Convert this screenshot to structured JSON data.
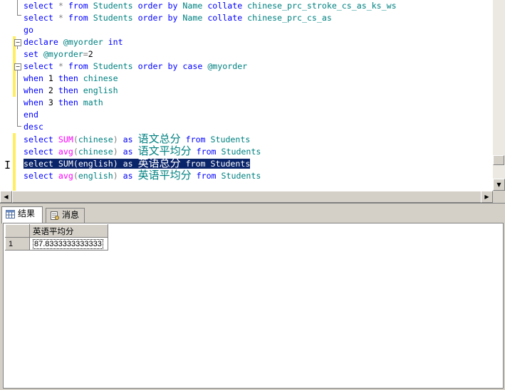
{
  "editor": {
    "lines": [
      [
        {
          "c": "kw",
          "t": "select"
        },
        {
          "c": "tx",
          "t": " "
        },
        {
          "c": "gr",
          "t": "*"
        },
        {
          "c": "tx",
          "t": " "
        },
        {
          "c": "kw",
          "t": "from"
        },
        {
          "c": "tx",
          "t": " "
        },
        {
          "c": "tl",
          "t": "Students"
        },
        {
          "c": "tx",
          "t": " "
        },
        {
          "c": "kw",
          "t": "order by"
        },
        {
          "c": "tx",
          "t": " "
        },
        {
          "c": "tl",
          "t": "Name"
        },
        {
          "c": "tx",
          "t": " "
        },
        {
          "c": "kw",
          "t": "collate"
        },
        {
          "c": "tx",
          "t": " "
        },
        {
          "c": "tl",
          "t": "chinese_prc_stroke_cs_as_ks_ws"
        }
      ],
      [
        {
          "c": "kw",
          "t": "select"
        },
        {
          "c": "tx",
          "t": " "
        },
        {
          "c": "gr",
          "t": "*"
        },
        {
          "c": "tx",
          "t": " "
        },
        {
          "c": "kw",
          "t": "from"
        },
        {
          "c": "tx",
          "t": " "
        },
        {
          "c": "tl",
          "t": "Students"
        },
        {
          "c": "tx",
          "t": " "
        },
        {
          "c": "kw",
          "t": "order by"
        },
        {
          "c": "tx",
          "t": " "
        },
        {
          "c": "tl",
          "t": "Name"
        },
        {
          "c": "tx",
          "t": " "
        },
        {
          "c": "kw",
          "t": "collate"
        },
        {
          "c": "tx",
          "t": " "
        },
        {
          "c": "tl",
          "t": "chinese_prc_cs_as"
        }
      ],
      [
        {
          "c": "kw",
          "t": "go"
        }
      ],
      [
        {
          "c": "kw",
          "t": "declare"
        },
        {
          "c": "tx",
          "t": " "
        },
        {
          "c": "tl",
          "t": "@myorder"
        },
        {
          "c": "tx",
          "t": " "
        },
        {
          "c": "kw",
          "t": "int"
        }
      ],
      [
        {
          "c": "kw",
          "t": "set"
        },
        {
          "c": "tx",
          "t": " "
        },
        {
          "c": "tl",
          "t": "@myorder"
        },
        {
          "c": "gr",
          "t": "="
        },
        {
          "c": "tx",
          "t": "2"
        }
      ],
      [
        {
          "c": "kw",
          "t": "select"
        },
        {
          "c": "tx",
          "t": " "
        },
        {
          "c": "gr",
          "t": "*"
        },
        {
          "c": "tx",
          "t": " "
        },
        {
          "c": "kw",
          "t": "from"
        },
        {
          "c": "tx",
          "t": " "
        },
        {
          "c": "tl",
          "t": "Students"
        },
        {
          "c": "tx",
          "t": " "
        },
        {
          "c": "kw",
          "t": "order by"
        },
        {
          "c": "tx",
          "t": " "
        },
        {
          "c": "kw",
          "t": "case"
        },
        {
          "c": "tx",
          "t": " "
        },
        {
          "c": "tl",
          "t": "@myorder"
        }
      ],
      [
        {
          "c": "kw",
          "t": "when"
        },
        {
          "c": "tx",
          "t": " 1 "
        },
        {
          "c": "kw",
          "t": "then"
        },
        {
          "c": "tx",
          "t": " "
        },
        {
          "c": "tl",
          "t": "chinese"
        }
      ],
      [
        {
          "c": "kw",
          "t": "when"
        },
        {
          "c": "tx",
          "t": " 2 "
        },
        {
          "c": "kw",
          "t": "then"
        },
        {
          "c": "tx",
          "t": " "
        },
        {
          "c": "tl",
          "t": "english"
        }
      ],
      [
        {
          "c": "kw",
          "t": "when"
        },
        {
          "c": "tx",
          "t": " 3 "
        },
        {
          "c": "kw",
          "t": "then"
        },
        {
          "c": "tx",
          "t": " "
        },
        {
          "c": "tl",
          "t": "math"
        }
      ],
      [
        {
          "c": "kw",
          "t": "end"
        }
      ],
      [
        {
          "c": "kw",
          "t": "desc"
        }
      ],
      [
        {
          "c": "kw",
          "t": "select"
        },
        {
          "c": "tx",
          "t": " "
        },
        {
          "c": "fn",
          "t": "SUM"
        },
        {
          "c": "gr",
          "t": "("
        },
        {
          "c": "tl",
          "t": "chinese"
        },
        {
          "c": "gr",
          "t": ")"
        },
        {
          "c": "tx",
          "t": " "
        },
        {
          "c": "kw",
          "t": "as"
        },
        {
          "c": "tx",
          "t": " "
        },
        {
          "c": "cjk",
          "t": "语文总分"
        },
        {
          "c": "tx",
          "t": " "
        },
        {
          "c": "kw",
          "t": "from"
        },
        {
          "c": "tx",
          "t": " "
        },
        {
          "c": "tl",
          "t": "Students"
        }
      ],
      [
        {
          "c": "kw",
          "t": "select"
        },
        {
          "c": "tx",
          "t": " "
        },
        {
          "c": "fn",
          "t": "avg"
        },
        {
          "c": "gr",
          "t": "("
        },
        {
          "c": "tl",
          "t": "chinese"
        },
        {
          "c": "gr",
          "t": ")"
        },
        {
          "c": "tx",
          "t": " "
        },
        {
          "c": "kw",
          "t": "as"
        },
        {
          "c": "tx",
          "t": " "
        },
        {
          "c": "cjk",
          "t": "语文平均分"
        },
        {
          "c": "tx",
          "t": " "
        },
        {
          "c": "kw",
          "t": "from"
        },
        {
          "c": "tx",
          "t": " "
        },
        {
          "c": "tl",
          "t": "Students"
        }
      ],
      [
        {
          "c": "kw",
          "t": "select"
        },
        {
          "c": "tx",
          "t": " "
        },
        {
          "c": "fn",
          "t": "SUM"
        },
        {
          "c": "gr",
          "t": "("
        },
        {
          "c": "tl",
          "t": "english"
        },
        {
          "c": "gr",
          "t": ")"
        },
        {
          "c": "tx",
          "t": " "
        },
        {
          "c": "kw",
          "t": "as"
        },
        {
          "c": "tx",
          "t": " "
        },
        {
          "c": "cjk",
          "t": "英语总分"
        },
        {
          "c": "tx",
          "t": " "
        },
        {
          "c": "kw",
          "t": "from"
        },
        {
          "c": "tx",
          "t": " "
        },
        {
          "c": "tl",
          "t": "Students"
        }
      ],
      [
        {
          "c": "kw",
          "t": "select"
        },
        {
          "c": "tx",
          "t": " "
        },
        {
          "c": "fn",
          "t": "avg"
        },
        {
          "c": "gr",
          "t": "("
        },
        {
          "c": "tl",
          "t": "english"
        },
        {
          "c": "gr",
          "t": ")"
        },
        {
          "c": "tx",
          "t": " "
        },
        {
          "c": "kw",
          "t": "as"
        },
        {
          "c": "tx",
          "t": " "
        },
        {
          "c": "cjk",
          "t": "英语平均分"
        },
        {
          "c": "tx",
          "t": " "
        },
        {
          "c": "kw",
          "t": "from"
        },
        {
          "c": "tx",
          "t": " "
        },
        {
          "c": "tl",
          "t": "Students"
        }
      ]
    ],
    "selected_line": 13,
    "colors": {
      "keyword": "#0000ff",
      "identifier": "#008080",
      "function": "#ff00ff",
      "operator": "#808080",
      "selection": "#0a246a",
      "change_bar": "#ffee62"
    }
  },
  "tabs": {
    "results_label": "结果",
    "messages_label": "消息",
    "results_icon": "grid-icon",
    "messages_icon": "document-icon"
  },
  "results": {
    "columns": [
      "英语平均分"
    ],
    "rows": [
      {
        "row_number": "1",
        "values": [
          "87.8333333333333"
        ]
      }
    ]
  }
}
